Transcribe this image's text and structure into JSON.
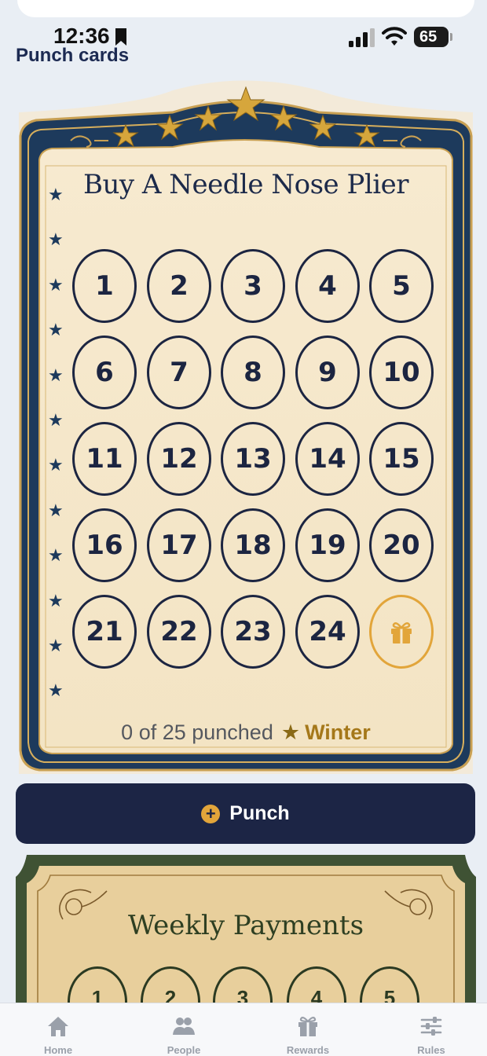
{
  "status_bar": {
    "time": "12:36",
    "battery": "65"
  },
  "page_title": "Punch cards",
  "card1": {
    "title": "Buy A Needle Nose Plier",
    "slots": [
      "1",
      "2",
      "3",
      "4",
      "5",
      "6",
      "7",
      "8",
      "9",
      "10",
      "11",
      "12",
      "13",
      "14",
      "15",
      "16",
      "17",
      "18",
      "19",
      "20",
      "21",
      "22",
      "23",
      "24"
    ],
    "reward_icon": "gift-icon",
    "status": "0 of 25 punched",
    "status_star": "★",
    "season": "Winter",
    "colors": {
      "frame": "#1d3a5c",
      "gold": "#d6a63c",
      "paper": "#f6e9cd",
      "ink": "#1c2541",
      "reward": "#e2a53a"
    }
  },
  "punch_button": {
    "label": "Punch",
    "icon": "plus-circle-icon"
  },
  "card2": {
    "title": "Weekly Payments",
    "slots": [
      "1",
      "2",
      "3",
      "4",
      "5"
    ],
    "colors": {
      "frame": "#3f5234",
      "paper": "#e8cf9c",
      "ink": "#2b3a22"
    }
  },
  "tab_bar": {
    "items": [
      {
        "label": "Home",
        "icon": "home-icon"
      },
      {
        "label": "People",
        "icon": "people-icon"
      },
      {
        "label": "Rewards",
        "icon": "gift-icon"
      },
      {
        "label": "Rules",
        "icon": "sliders-icon"
      }
    ]
  }
}
